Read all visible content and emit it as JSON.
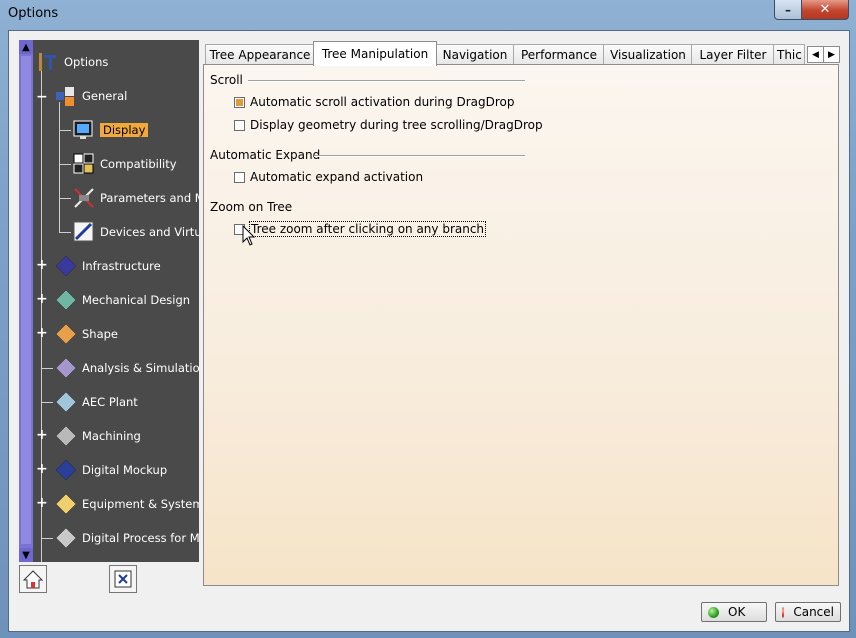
{
  "window": {
    "title": "Options",
    "minimize_glyph": "–",
    "close_glyph": "✕"
  },
  "tree": {
    "root": {
      "label": "Options",
      "icon": "options-icon"
    },
    "general": {
      "label": "General",
      "icon": "general-icon"
    },
    "children": [
      {
        "label": "Display",
        "icon": "display-icon",
        "selected": true
      },
      {
        "label": "Compatibility",
        "icon": "compatibility-icon"
      },
      {
        "label": "Parameters and Measure",
        "icon": "parameters-icon"
      },
      {
        "label": "Devices and Virtual Reality",
        "icon": "devices-icon"
      }
    ],
    "workbenches": [
      {
        "label": "Infrastructure",
        "icon": "infrastructure-icon",
        "expandable": true,
        "color": "#3a3a9e"
      },
      {
        "label": "Mechanical Design",
        "icon": "mechanical-design-icon",
        "expandable": true,
        "color": "#6fb7a4"
      },
      {
        "label": "Shape",
        "icon": "shape-icon",
        "expandable": true,
        "color": "#e6a04a"
      },
      {
        "label": "Analysis & Simulation",
        "icon": "analysis-icon",
        "expandable": false,
        "color": "#a597c9"
      },
      {
        "label": "AEC Plant",
        "icon": "aec-plant-icon",
        "expandable": false,
        "color": "#9fc7d9"
      },
      {
        "label": "Machining",
        "icon": "machining-icon",
        "expandable": true,
        "color": "#b9b9b9"
      },
      {
        "label": "Digital Mockup",
        "icon": "digital-mockup-icon",
        "expandable": true,
        "color": "#2a3f9a"
      },
      {
        "label": "Equipment & Systems",
        "icon": "equipment-icon",
        "expandable": true,
        "color": "#f2cf6e"
      },
      {
        "label": "Digital Process for Manufacturing",
        "icon": "digital-process-icon",
        "expandable": false,
        "color": "#c8c8c8"
      }
    ]
  },
  "tabs": [
    {
      "label": "Tree Appearance",
      "active": false
    },
    {
      "label": "Tree Manipulation",
      "active": true
    },
    {
      "label": "Navigation",
      "active": false
    },
    {
      "label": "Performance",
      "active": false
    },
    {
      "label": "Visualization",
      "active": false
    },
    {
      "label": "Layer Filter",
      "active": false
    },
    {
      "label": "Thic",
      "active": false
    }
  ],
  "groups": {
    "scroll": {
      "title": "Scroll",
      "options": [
        {
          "label": "Automatic scroll activation during DragDrop",
          "checked": true
        },
        {
          "label": "Display geometry during tree scrolling/DragDrop",
          "checked": false
        }
      ]
    },
    "expand": {
      "title": "Automatic Expand",
      "options": [
        {
          "label": "Automatic expand activation",
          "checked": false
        }
      ]
    },
    "zoom": {
      "title": "Zoom on Tree",
      "options": [
        {
          "label": "Tree zoom after clicking on any branch",
          "checked": false
        }
      ]
    }
  },
  "buttons": {
    "ok": "OK",
    "cancel": "Cancel"
  },
  "colors": {
    "accent": "#f2a93b",
    "tree_bg": "#4a4a4a",
    "scrollbar": "#7a73d6"
  }
}
